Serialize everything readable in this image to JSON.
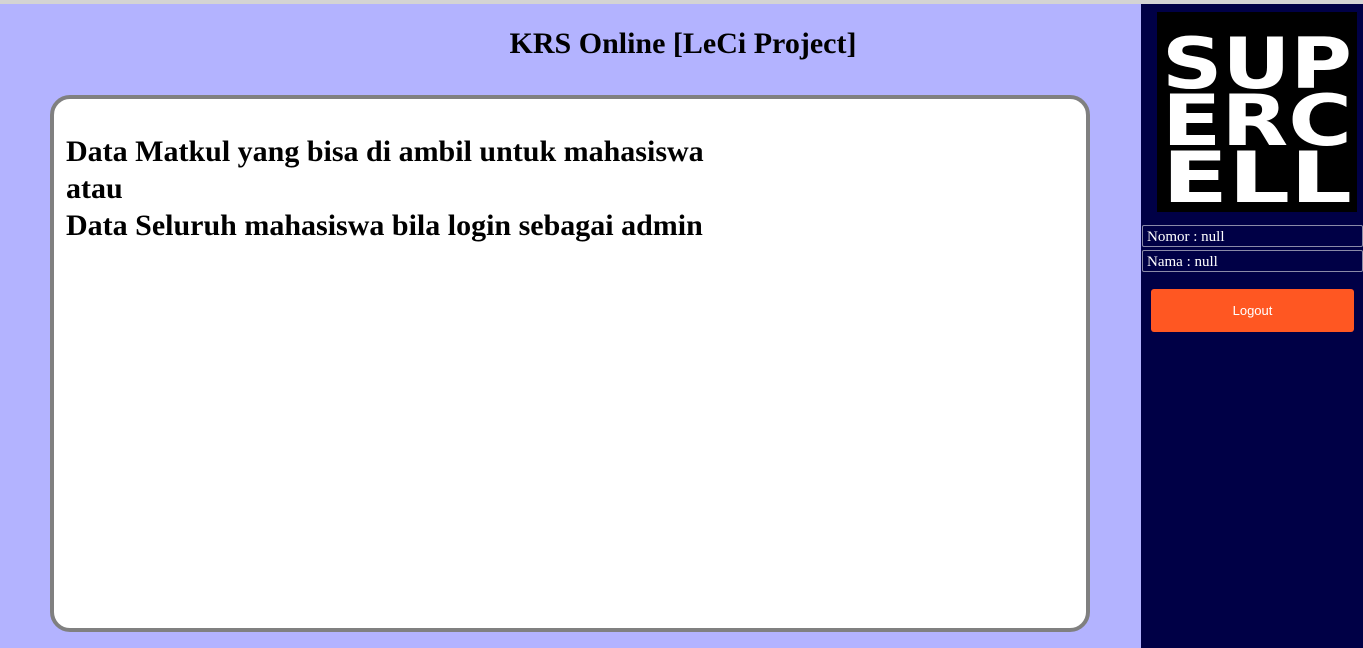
{
  "header": {
    "title": "KRS Online [LeCi Project]"
  },
  "main": {
    "lines": [
      "Data Matkul yang bisa di ambil untuk mahasiswa",
      "atau",
      "Data Seluruh mahasiswa bila login sebagai admin"
    ]
  },
  "sidebar": {
    "logo": {
      "rows": [
        "SUP",
        "ERC",
        "ELL"
      ],
      "icon": "supercell-logo"
    },
    "nomor": "Nomor : null",
    "nama": "Nama : null",
    "logout_label": "Logout"
  },
  "colors": {
    "main_background": "#b3b3ff",
    "sidebar_background": "#000046",
    "logout_button": "#ff5722",
    "content_border": "#808080"
  }
}
